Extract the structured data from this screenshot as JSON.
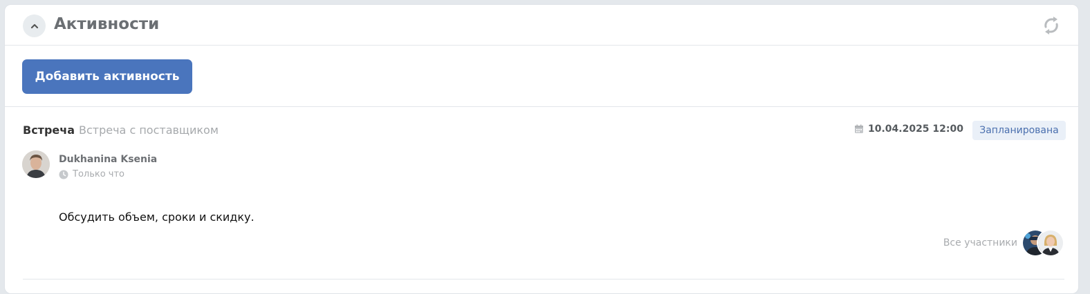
{
  "header": {
    "title": "Активности",
    "collapse_icon": "chevron-up-icon",
    "refresh_icon": "refresh-icon"
  },
  "toolbar": {
    "add_label": "Добавить активность"
  },
  "activity": {
    "type": "Встреча",
    "subject": "Встреча с поставщиком",
    "date": "10.04.2025 12:00",
    "status": "Запланирована",
    "author": "Dukhanina Ksenia",
    "time_ago": "Только что",
    "body": "Обсудить объем, сроки и скидку.",
    "participants_label": "Все участники"
  },
  "colors": {
    "accent": "#4a75bd",
    "status_bg": "#eaf0f8",
    "status_text": "#4a6fae"
  }
}
